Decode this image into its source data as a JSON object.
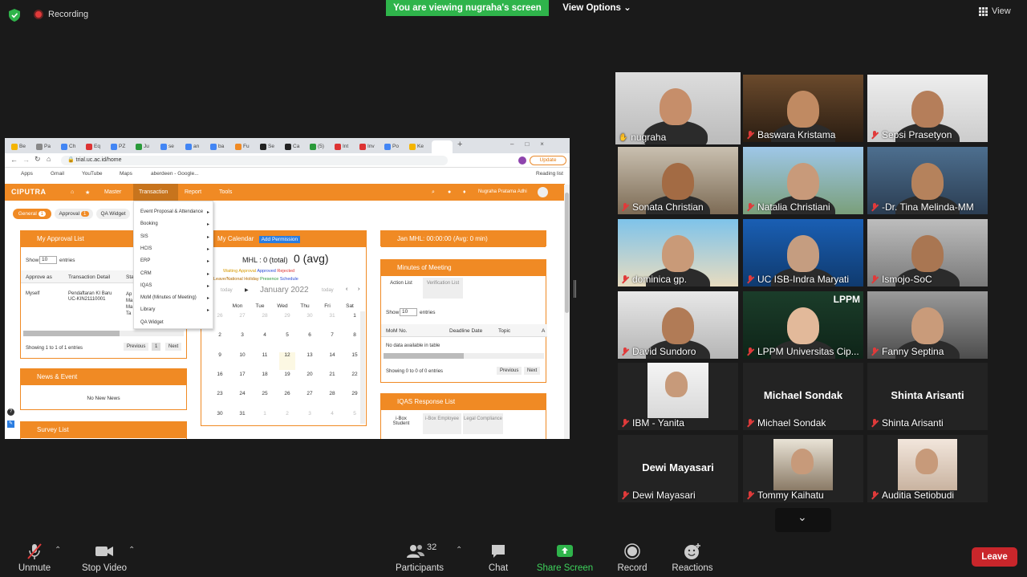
{
  "topbar": {
    "recording_label": "Recording",
    "viewing_banner": "You are viewing nugraha's screen",
    "view_options_label": "View Options",
    "view_label": "View"
  },
  "shared_screen": {
    "browser": {
      "tabs": [
        "Be",
        "Pa",
        "Ch",
        "Eq",
        "PZ",
        "Ju",
        "se",
        "an",
        "ba",
        "Fu",
        "Se",
        "Ca",
        "(5)",
        "Int",
        "Inv",
        "Po",
        "Ke"
      ],
      "url": "trial.uc.ac.id/home",
      "update_label": "Update",
      "bookmarks": [
        "Apps",
        "Gmail",
        "YouTube",
        "Maps",
        "aberdeen - Google..."
      ],
      "reading_list": "Reading list"
    },
    "app": {
      "logo": "CIPUTRA",
      "nav": [
        "Master",
        "Transaction",
        "Report",
        "Tools"
      ],
      "user_name": "Nugraha Pratama Adhi",
      "subtabs": {
        "general": "General",
        "general_count": "1",
        "approval": "Approval",
        "approval_count": "1",
        "qa_widget": "QA Widget"
      },
      "transaction_menu": [
        "Event Proposal & Attendance",
        "Booking",
        "SIS",
        "HCIS",
        "ERP",
        "CRM",
        "IQAS",
        "MoM (Minutes of Meeting)",
        "Library",
        "QA Widget"
      ],
      "approval_list": {
        "title": "My Approval List",
        "show": "Show",
        "entries_value": "10",
        "entries": "entries",
        "columns": [
          "Approve as",
          "Transaction Detail",
          "Sta"
        ],
        "row": {
          "approve_as": "Myself",
          "detail_1": "Pendaftaran KI Baru",
          "detail_2": "UC-KIN21110001",
          "status": "Ap Ma Ma Ta"
        },
        "footer": "Showing 1 to 1 of 1 entries",
        "prev": "Previous",
        "page": "1",
        "next": "Next"
      },
      "news": {
        "title": "News & Event",
        "empty": "No New News"
      },
      "survey": {
        "title": "Survey List"
      },
      "calendar": {
        "title": "My Calendar",
        "add_permission": "Add Permission",
        "mhl_total": "MHL : 0 (total)",
        "avg": "0 (avg)",
        "legend_waiting": "Waiting Approval",
        "legend_approved": "Approved",
        "legend_rejected": "Rejected",
        "legend_leave": "Leave/National Holiday",
        "legend_presence": "Presence",
        "legend_schedule": "Schedule",
        "today": "today",
        "month": "January 2022",
        "days": [
          "n",
          "Mon",
          "Tue",
          "Wed",
          "Thu",
          "Fri",
          "Sat"
        ],
        "weeks": [
          [
            "26",
            "27",
            "28",
            "29",
            "30",
            "31",
            "1"
          ],
          [
            "2",
            "3",
            "4",
            "5",
            "6",
            "7",
            "8"
          ],
          [
            "9",
            "10",
            "11",
            "12",
            "13",
            "14",
            "15"
          ],
          [
            "16",
            "17",
            "18",
            "19",
            "20",
            "21",
            "22"
          ],
          [
            "23",
            "24",
            "25",
            "26",
            "27",
            "28",
            "29"
          ],
          [
            "30",
            "31",
            "1",
            "2",
            "3",
            "4",
            "5"
          ]
        ]
      },
      "mhl_panel": {
        "title": "Jan MHL: 00:00:00 (Avg: 0 min)"
      },
      "minutes": {
        "title": "Minutes of Meeting",
        "tab_action": "Action List",
        "tab_verification": "Verification List",
        "show": "Show",
        "entries_value": "10",
        "entries": "entries",
        "columns": [
          "MoM No.",
          "Deadline Date",
          "Topic",
          "A"
        ],
        "empty": "No data available in table",
        "footer": "Showing 0 to 0 of 0 entries",
        "prev": "Previous",
        "next": "Next"
      },
      "iqas": {
        "title": "IQAS Response List",
        "tab_student": "i-Box Student",
        "tab_employee": "i-Box Employee",
        "tab_legal": "Legal Compliance"
      }
    }
  },
  "participants": [
    {
      "name": "nugraha",
      "video": true
    },
    {
      "name": "Baswara Kristama",
      "video": true
    },
    {
      "name": "Sepsi Prasetyon",
      "video": true
    },
    {
      "name": "Sonata Christian",
      "video": true
    },
    {
      "name": "Natalia Christiani",
      "video": true
    },
    {
      "name": "-Dr. Tina Melinda-MM",
      "video": true
    },
    {
      "name": "dominica gp.",
      "video": true
    },
    {
      "name": "UC ISB-Indra Maryati",
      "video": true
    },
    {
      "name": "Ismojo-SoC",
      "video": true
    },
    {
      "name": "David Sundoro",
      "video": true
    },
    {
      "name": "LPPM Universitas Cip...",
      "video": true,
      "overlay": "LPPM"
    },
    {
      "name": "Fanny Septina",
      "video": true
    },
    {
      "name": "IBM - Yanita",
      "video": false
    },
    {
      "name": "Michael Sondak",
      "video": false,
      "big": "Michael Sondak"
    },
    {
      "name": "Shinta Arisanti",
      "video": false,
      "big": "Shinta Arisanti"
    },
    {
      "name": "Dewi Mayasari",
      "video": false,
      "big": "Dewi Mayasari"
    },
    {
      "name": "Tommy Kaihatu",
      "video": false
    },
    {
      "name": "Auditia Setiobudi",
      "video": false
    }
  ],
  "toolbar": {
    "unmute": "Unmute",
    "stop_video": "Stop Video",
    "participants": "Participants",
    "participants_count": "32",
    "chat": "Chat",
    "share_screen": "Share Screen",
    "record": "Record",
    "reactions": "Reactions",
    "leave": "Leave"
  },
  "colors": {
    "accent_orange": "#f08a24",
    "zoom_green": "#2fb44b",
    "leave_red": "#c9262b",
    "active_speaker": "#c8dc3c"
  }
}
